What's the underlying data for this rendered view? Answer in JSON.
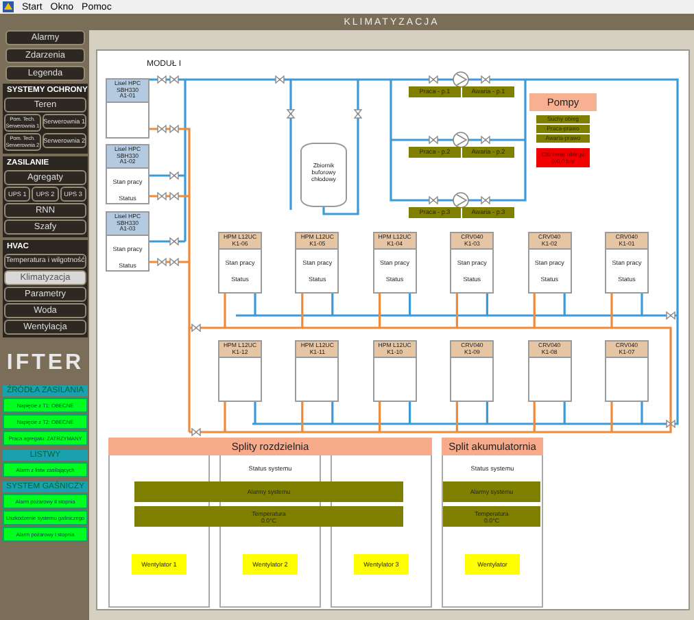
{
  "menu_bar": [
    "Start",
    "Okno",
    "Pomoc"
  ],
  "page_title": "KLIMATYZACJA",
  "sidebar": {
    "nav_top": [
      {
        "label": "Alarmy",
        "selected": false
      },
      {
        "label": "Zdarzenia",
        "selected": false
      },
      {
        "label": "Legenda",
        "selected": false
      }
    ],
    "sections": [
      {
        "title": "SYSTEMY OCHRONY",
        "rows": [
          [
            {
              "label": "Teren",
              "selected": false
            }
          ],
          [
            {
              "label": "Pom. Tech. Serwerownia 1",
              "selected": false
            },
            {
              "label": "Serwerownia 1",
              "selected": false
            }
          ],
          [
            {
              "label": "Pom. Tech. Serwerownia 2",
              "selected": false
            },
            {
              "label": "Serwerownia 2",
              "selected": false
            }
          ]
        ]
      },
      {
        "title": "ZASILANIE",
        "rows": [
          [
            {
              "label": "Agregaty",
              "selected": false
            }
          ],
          [
            {
              "label": "UPS 1",
              "selected": false
            },
            {
              "label": "UPS 2",
              "selected": false
            },
            {
              "label": "UPS 3",
              "selected": false
            }
          ],
          [
            {
              "label": "RNN",
              "selected": false
            }
          ],
          [
            {
              "label": "Szafy",
              "selected": false
            }
          ]
        ]
      },
      {
        "title": "HVAC",
        "rows": [
          [
            {
              "label": "Temperatura i wilgotność",
              "selected": false
            }
          ],
          [
            {
              "label": "Klimatyzacja",
              "selected": true
            }
          ],
          [
            {
              "label": "Parametry",
              "selected": false
            }
          ],
          [
            {
              "label": "Woda",
              "selected": false
            }
          ],
          [
            {
              "label": "Wentylacja",
              "selected": false
            }
          ]
        ]
      }
    ],
    "logo": "IFTER",
    "status_sections": [
      {
        "title": "ŹRÓDŁA ZASILANIA",
        "items": [
          "Napięcie z T1: OBECNE",
          "Napięcie z T2: OBECNE",
          "Praca agregatu: ZATRZYMANY"
        ]
      },
      {
        "title": "LISTWY",
        "items": [
          "Alarm z listw zasilających"
        ]
      },
      {
        "title": "SYSTEM GAŚNICZY",
        "items": [
          "Alarm pożarowy II stopnia",
          "Uszkodzenie systemu gaśniczego",
          "Alarm pożarowy I stopnia"
        ]
      }
    ]
  },
  "diagram": {
    "module_label": "MODUŁ I",
    "lisel_units": [
      {
        "name": "Lisel HPC",
        "model": "SBH330",
        "tag": "A1-01"
      },
      {
        "name": "Lisel HPC",
        "model": "SBH330",
        "tag": "A1-02",
        "fields": [
          "Stan pracy",
          "Status"
        ]
      },
      {
        "name": "Lisel HPC",
        "model": "SBH330",
        "tag": "A1-03",
        "fields": [
          "Stan pracy",
          "Status"
        ]
      }
    ],
    "tank": "Zbiornik buforowy chłodowy",
    "pumps": [
      {
        "running": "Praca - p.1",
        "fault": "Awaria - p.1"
      },
      {
        "running": "Praca - p.2",
        "fault": "Awaria - p.2"
      },
      {
        "running": "Praca - p.3",
        "fault": "Awaria - p.3"
      }
    ],
    "pump_panel": {
      "title": "Pompy",
      "indicators": [
        "Suchy obieg",
        "Praca-prawo",
        "Awaria-prawo"
      ],
      "alarm_lines": [
        "Ciśnienie obiegu",
        "0-0,0 bar"
      ]
    },
    "unit_rows": [
      [
        {
          "model": "HPM L12UC",
          "tag": "K1-06",
          "fields": [
            "Stan pracy",
            "Status"
          ]
        },
        {
          "model": "HPM L12UC",
          "tag": "K1-05",
          "fields": [
            "Stan pracy",
            "Status"
          ]
        },
        {
          "model": "HPM L12UC",
          "tag": "K1-04",
          "fields": [
            "Stan pracy",
            "Status"
          ]
        },
        {
          "model": "CRV040",
          "tag": "K1-03",
          "fields": [
            "Stan pracy",
            "Status"
          ]
        },
        {
          "model": "CRV040",
          "tag": "K1-02",
          "fields": [
            "Stan pracy",
            "Status"
          ]
        },
        {
          "model": "CRV040",
          "tag": "K1-01",
          "fields": [
            "Stan pracy",
            "Status"
          ]
        }
      ],
      [
        {
          "model": "HPM L12UC",
          "tag": "K1-12"
        },
        {
          "model": "HPM L12UC",
          "tag": "K1-11"
        },
        {
          "model": "HPM L12UC",
          "tag": "K1-10"
        },
        {
          "model": "CRV040",
          "tag": "K1-09"
        },
        {
          "model": "CRV040",
          "tag": "K1-08"
        },
        {
          "model": "CRV040",
          "tag": "K1-07"
        }
      ]
    ],
    "split_groups": [
      {
        "title": "Splity rozdzielnia",
        "status": "Status systemu",
        "alarm": "Alarmy systemu",
        "temperature_label": "Temperatura",
        "temperature": "0.0°C",
        "fans": [
          "Wentylator 1",
          "Wentylator 2",
          "Wentylator 3"
        ]
      },
      {
        "title": "Split akumulatornia",
        "status": "Status systemu",
        "alarm": "Alarmy systemu",
        "temperature_label": "Temperatura",
        "temperature": "0.0°C",
        "fans": [
          "Wentylator"
        ]
      }
    ]
  }
}
